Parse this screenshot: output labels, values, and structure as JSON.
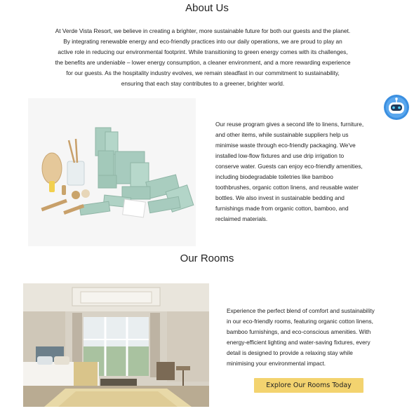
{
  "about": {
    "title": "About Us",
    "lines": [
      "At Verde Vista Resort, we believe in creating a brighter, more sustainable future for both our guests and the planet.",
      "By integrating renewable energy and eco-friendly practices into our daily operations, we are proud to play an",
      "active role in reducing our environmental footprint. While transitioning to green energy comes with its challenges,",
      "the benefits are undeniable – lower energy consumption, a cleaner environment, and a more rewarding experience",
      "for our guests. As the hospitality industry evolves, we remain steadfast in our commitment to sustainability,",
      "ensuring that each stay contributes to a greener, brighter world."
    ]
  },
  "reuse": {
    "lines": [
      "Our reuse program gives a second life to linens, furniture,",
      "and other items, while sustainable suppliers help us",
      "minimise waste through eco-friendly packaging. We've",
      "installed low-flow fixtures and use drip irrigation to",
      "conserve water. Guests can enjoy eco-friendly amenities,",
      "including biodegradable toiletries like bamboo",
      "toothbrushes, organic cotton linens, and reusable water",
      "bottles. We also invest in sustainable bedding and",
      "furnishings made from organic cotton, bamboo, and",
      "reclaimed materials."
    ]
  },
  "rooms": {
    "title": "Our Rooms",
    "lines": [
      "Experience the perfect blend of comfort and sustainability",
      "in our eco-friendly rooms, featuring organic cotton linens,",
      "bamboo furnishings, and eco-conscious amenities. With",
      "energy-efficient lighting and water-saving fixtures, every",
      "detail is designed to provide a relaxing stay while",
      "minimising your environmental impact."
    ],
    "cta_label": "Explore Our Rooms Today"
  },
  "colors": {
    "cta_background": "#f3d36f",
    "amenity_green": "#9fc7b8",
    "chatbot_blue": "#3b8fe0"
  },
  "icons": {
    "chatbot": "robot-chat-icon"
  }
}
